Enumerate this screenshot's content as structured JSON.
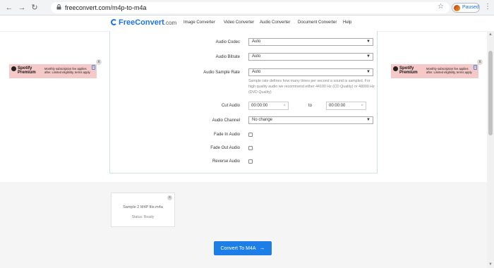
{
  "browser": {
    "url": "freeconvert.com/m4p-to-m4a",
    "profile_status": "Paused"
  },
  "header": {
    "logo_text": "FreeConvert",
    "logo_suffix": ".com",
    "nav": [
      "Image Converter",
      "Video Converter",
      "Audio Converter",
      "Document Converter",
      "Help"
    ]
  },
  "settings": {
    "audio_codec": {
      "label": "Audio Codec",
      "value": "Auto"
    },
    "audio_bitrate": {
      "label": "Audio Bitrate",
      "value": "Auto"
    },
    "audio_sample_rate": {
      "label": "Audio Sample Rate",
      "value": "Auto",
      "hint": "Sample rate defines how many times per second a sound is sampled. For high quality audio we recommend either 44100 Hz (CD Quality) or 48000 Hz (DVD Quality)"
    },
    "cut_audio": {
      "label": "Cut Audio",
      "start": "00:00:00",
      "to": "to",
      "end": "00:00:00"
    },
    "audio_channel": {
      "label": "Audio Channel",
      "value": "No change"
    },
    "fade_in": {
      "label": "Fade In Audio",
      "checked": false
    },
    "fade_out": {
      "label": "Fade Out Audio",
      "checked": false
    },
    "reverse": {
      "label": "Reverse Audio",
      "checked": false
    }
  },
  "ads": {
    "brand_line1": "Spotify",
    "brand_line2": "Premium",
    "text": "Monthly subscription fee applies after. Limited eligibility, terms apply.",
    "info": "i",
    "close": "x"
  },
  "file": {
    "name": "Sample 2 M4P file.m4a",
    "status": "Status: Ready",
    "close": "x"
  },
  "convert_button": {
    "label": "Convert To M4A",
    "arrow": "→"
  },
  "colors": {
    "accent": "#1e7ee8",
    "ad_background": "#f6c9c9"
  }
}
